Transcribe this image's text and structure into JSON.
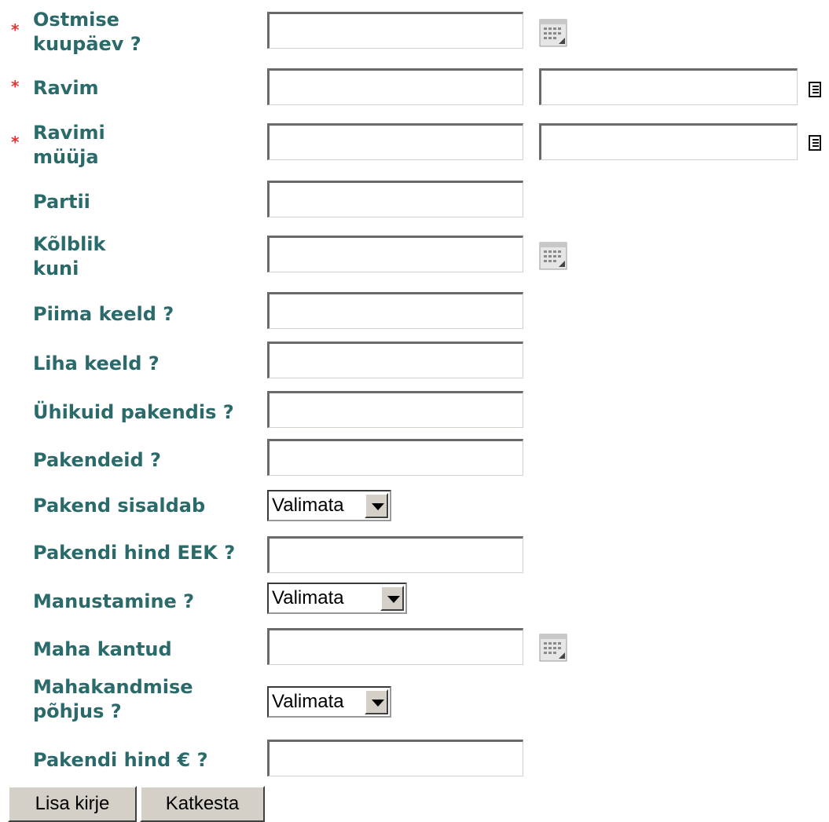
{
  "form": {
    "fields": [
      {
        "label": "Ostmise kuupäev ?",
        "required": true
      },
      {
        "label": "Ravim",
        "required": true
      },
      {
        "label": "Ravimi müüja",
        "required": true
      },
      {
        "label": "Partii",
        "required": false
      },
      {
        "label": "Kõlblik kuni",
        "required": false
      },
      {
        "label": "Piima keeld ?",
        "required": false
      },
      {
        "label": "Liha keeld ?",
        "required": false
      },
      {
        "label": "Ühikuid pakendis ?",
        "required": false
      },
      {
        "label": "Pakendeid ?",
        "required": false
      },
      {
        "label": "Pakend sisaldab",
        "required": false,
        "value": "Valimata"
      },
      {
        "label": "Pakendi hind EEK ?",
        "required": false
      },
      {
        "label": "Manustamine ?",
        "required": false,
        "value": "Valimata"
      },
      {
        "label": "Maha kantud",
        "required": false
      },
      {
        "label": "Mahakandmise põhjus ?",
        "required": false,
        "value": "Valimata"
      },
      {
        "label": "Pakendi hind € ?",
        "required": false
      }
    ],
    "label_lines": {
      "ostmise_1": "Ostmise",
      "ostmise_2": "kuupäev ?",
      "ravimi_1": "Ravimi",
      "ravimi_2": "müüja",
      "kolblik_1": "Kõlblik",
      "kolblik_2": "kuni",
      "mahak_1": "Mahakandmise",
      "mahak_2": "põhjus ?"
    },
    "required_marker": "*",
    "icons": {
      "calendar": "calendar-icon",
      "lookup": "list-lookup-icon"
    }
  },
  "buttons": {
    "add": "Lisa kirje",
    "cancel": "Katkesta"
  },
  "colors": {
    "label": "#2b6a6a",
    "required": "#e63333",
    "button": "#d4d0c8"
  }
}
